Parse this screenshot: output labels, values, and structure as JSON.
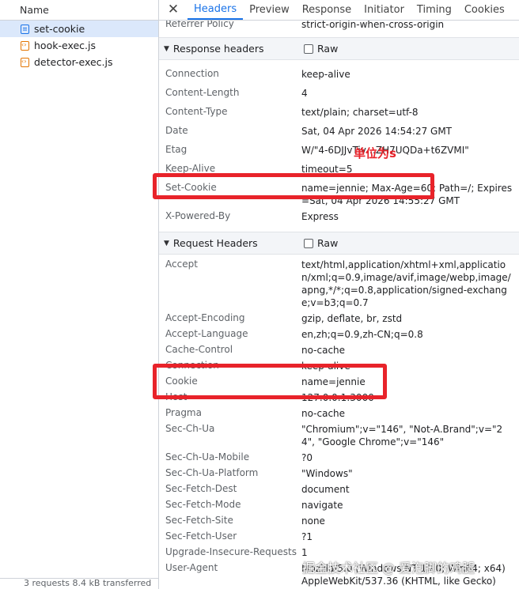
{
  "left_panel": {
    "header": "Name",
    "requests": [
      {
        "name": "set-cookie",
        "icon": "document-icon",
        "selected": true
      },
      {
        "name": "hook-exec.js",
        "icon": "script-icon",
        "selected": false
      },
      {
        "name": "detector-exec.js",
        "icon": "script-icon",
        "selected": false
      }
    ],
    "footer": "3 requests    8.4 kB transferred"
  },
  "tabs": [
    {
      "label": "Headers",
      "active": true
    },
    {
      "label": "Preview",
      "active": false
    },
    {
      "label": "Response",
      "active": false
    },
    {
      "label": "Initiator",
      "active": false
    },
    {
      "label": "Timing",
      "active": false
    },
    {
      "label": "Cookies",
      "active": false
    }
  ],
  "close_glyph": "✕",
  "general_tail": {
    "name": "Referrer Policy",
    "value": "strict-origin-when-cross-origin"
  },
  "response_headers": {
    "title": "Response headers",
    "raw_label": "Raw",
    "rows": [
      {
        "name": "Connection",
        "value": "keep-alive"
      },
      {
        "name": "Content-Length",
        "value": "4"
      },
      {
        "name": "Content-Type",
        "value": "text/plain; charset=utf-8"
      },
      {
        "name": "Date",
        "value": "Sat, 04 Apr 2026 14:54:27 GMT"
      },
      {
        "name": "Etag",
        "value": "W/\"4-6DJJvTiv…ZH7UQDa+t6ZVMI\""
      },
      {
        "name": "Keep-Alive",
        "value": "timeout=5"
      },
      {
        "name": "Set-Cookie",
        "value": "name=jennie; Max-Age=60; Path=/; Expires=Sat, 04 Apr 2026 14:55:27 GMT"
      },
      {
        "name": "X-Powered-By",
        "value": "Express"
      }
    ]
  },
  "request_headers": {
    "title": "Request Headers",
    "raw_label": "Raw",
    "rows": [
      {
        "name": "Accept",
        "value": "text/html,application/xhtml+xml,application/xml;q=0.9,image/avif,image/webp,image/apng,*/*;q=0.8,application/signed-exchange;v=b3;q=0.7"
      },
      {
        "name": "Accept-Encoding",
        "value": "gzip, deflate, br, zstd"
      },
      {
        "name": "Accept-Language",
        "value": "en,zh;q=0.9,zh-CN;q=0.8"
      },
      {
        "name": "Cache-Control",
        "value": "no-cache"
      },
      {
        "name": "Connection",
        "value": "keep-alive"
      },
      {
        "name": "Cookie",
        "value": "name=jennie"
      },
      {
        "name": "Host",
        "value": "127.0.0.1:3000"
      },
      {
        "name": "Pragma",
        "value": "no-cache"
      },
      {
        "name": "Sec-Ch-Ua",
        "value": "\"Chromium\";v=\"146\", \"Not-A.Brand\";v=\"24\", \"Google Chrome\";v=\"146\""
      },
      {
        "name": "Sec-Ch-Ua-Mobile",
        "value": "?0"
      },
      {
        "name": "Sec-Ch-Ua-Platform",
        "value": "\"Windows\""
      },
      {
        "name": "Sec-Fetch-Dest",
        "value": "document"
      },
      {
        "name": "Sec-Fetch-Mode",
        "value": "navigate"
      },
      {
        "name": "Sec-Fetch-Site",
        "value": "none"
      },
      {
        "name": "Sec-Fetch-User",
        "value": "?1"
      },
      {
        "name": "Upgrade-Insecure-Requests",
        "value": "1"
      },
      {
        "name": "User-Agent",
        "value": "Mozilla/5.0 (Windows NT 10.0; Win64; x64) AppleWebKit/537.36 (KHTML, like Gecko)"
      }
    ]
  },
  "annotation": {
    "text": "单位为s",
    "color": "#e8232a"
  },
  "watermark": "掘金技术社区 @ 爱泡脚的鸡腿",
  "colors": {
    "accent": "#1a73e8",
    "selected_row": "#dbe8fb",
    "highlight": "#e8232a"
  }
}
